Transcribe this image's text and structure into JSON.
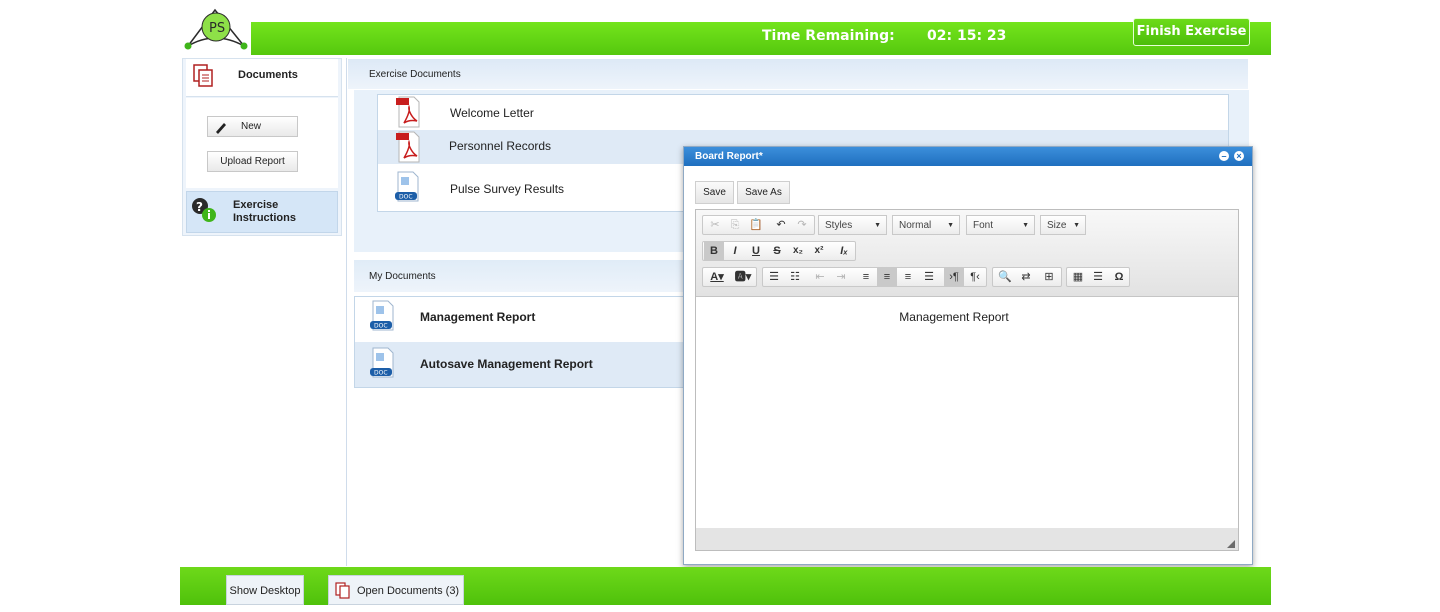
{
  "header": {
    "time_remaining_label": "Time Remaining:",
    "time_remaining_value": "02: 15: 23",
    "finish_button": "Finish Exercise",
    "logo_text": "PS"
  },
  "sidebar": {
    "documents_label": "Documents",
    "new_button": "New",
    "upload_button": "Upload Report",
    "instructions_label_1": "Exercise",
    "instructions_label_2": "Instructions"
  },
  "exercise_documents": {
    "header": "Exercise Documents",
    "items": [
      {
        "name": "Welcome Letter",
        "type": "pdf"
      },
      {
        "name": "Personnel Records",
        "type": "pdf"
      },
      {
        "name": "Pulse Survey Results",
        "type": "doc"
      }
    ]
  },
  "my_documents": {
    "header": "My Documents",
    "items": [
      {
        "name": "Management Report",
        "type": "doc"
      },
      {
        "name": "Autosave Management Report",
        "type": "doc"
      }
    ]
  },
  "report_window": {
    "title": "Board Report*",
    "save_button": "Save",
    "save_as_button": "Save As",
    "combos": {
      "styles": "Styles",
      "format": "Normal",
      "font": "Font",
      "size": "Size"
    },
    "content": "Management Report"
  },
  "taskbar": {
    "show_desktop": "Show Desktop",
    "open_documents": "Open Documents (3)"
  },
  "colors": {
    "brand_green": "#5fd314",
    "window_blue": "#1f6fbf",
    "panel_blue": "#e8f1fa"
  }
}
